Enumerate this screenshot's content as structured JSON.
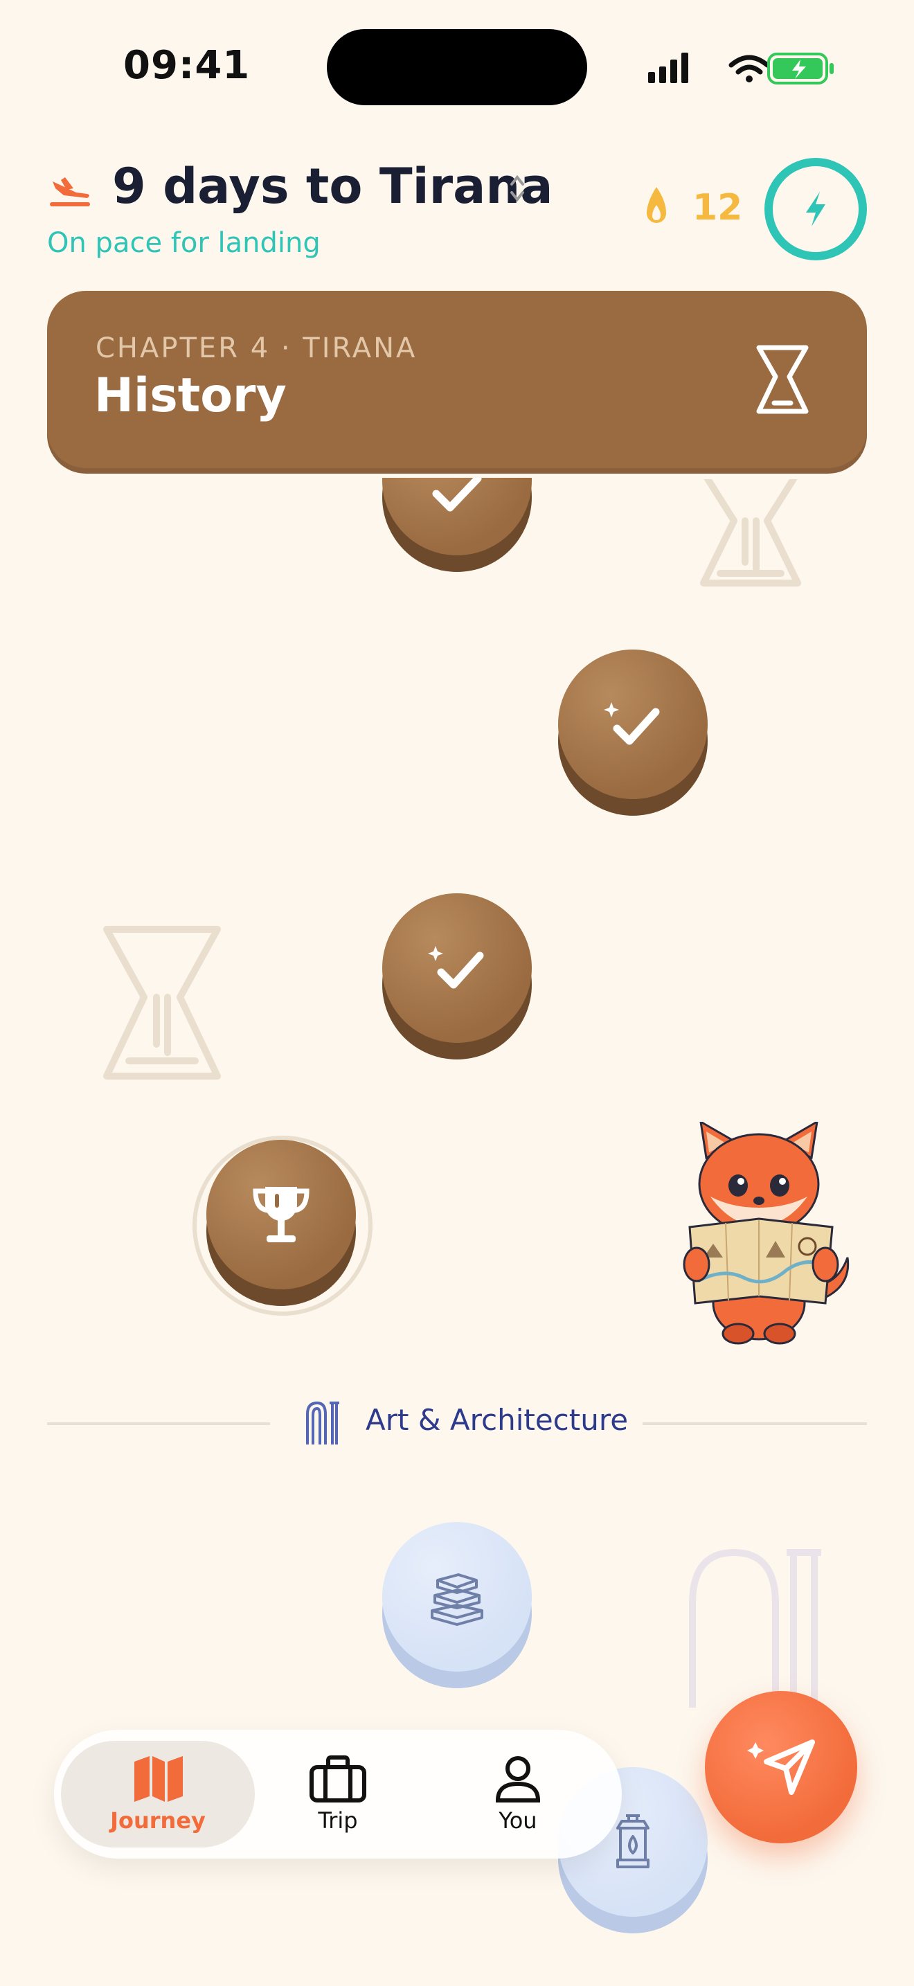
{
  "status_bar": {
    "time": "09:41"
  },
  "header": {
    "title": "9 days to Tirana",
    "subtitle": "On pace for landing",
    "streak_count": "12"
  },
  "banner": {
    "eyebrow": "CHAPTER 4 · TIRANA",
    "title": "History"
  },
  "section_divider": {
    "label": "Art & Architecture"
  },
  "tabs": [
    {
      "label": "Journey",
      "icon": "map-icon",
      "active": true
    },
    {
      "label": "Trip",
      "icon": "briefcase-icon",
      "active": false
    },
    {
      "label": "You",
      "icon": "person-icon",
      "active": false
    }
  ],
  "colors": {
    "accent": "#F26B3A",
    "teal": "#2EC4B6",
    "brown": "#9A6B41",
    "navy": "#2E3A8C",
    "background": "#FDF7EE"
  }
}
